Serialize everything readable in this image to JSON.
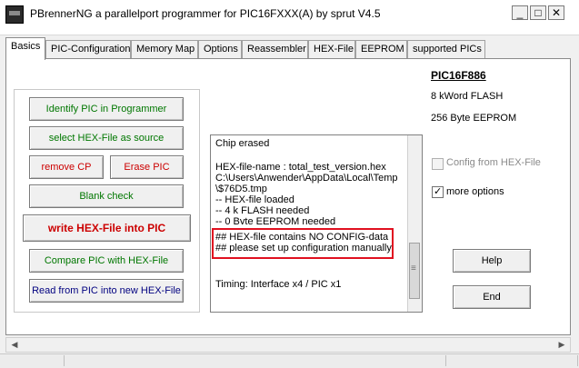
{
  "window": {
    "title": "PBrennerNG  a parallelport programmer for PIC16FXXX(A)  by sprut V4.5",
    "min_glyph": "_",
    "max_glyph": "□",
    "close_glyph": "✕"
  },
  "tabs": [
    {
      "label": "Basics"
    },
    {
      "label": "PIC-Configuration"
    },
    {
      "label": "Memory Map"
    },
    {
      "label": "Options"
    },
    {
      "label": "Reassembler"
    },
    {
      "label": "HEX-File"
    },
    {
      "label": "EEPROM"
    },
    {
      "label": "supported PICs"
    }
  ],
  "buttons": {
    "identify": "Identify PIC in Programmer",
    "select_hex": "select HEX-File as source",
    "remove_cp": "remove CP",
    "erase_pic": "Erase PIC",
    "blank_check": "Blank check",
    "write_hex": "write HEX-File into PIC",
    "compare": "Compare PIC with HEX-File",
    "read_from_pic": "Read from PIC into new HEX-File",
    "help": "Help",
    "end": "End"
  },
  "log": {
    "lines": [
      "Chip erased",
      "",
      "HEX-file-name : total_test_version.hex",
      "C:\\Users\\Anwender\\AppData\\Local\\Temp",
      "\\$76D5.tmp",
      "-- HEX-file loaded",
      "-- 4 k FLASH needed",
      "-- 0 Byte EEPROM needed",
      "## HEX-file contains NO CONFIG-data",
      "## please set up configuration manually",
      "",
      "",
      "Timing: Interface x4 / PIC x1"
    ]
  },
  "chip": {
    "name": "PIC16F886",
    "flash": "8 kWord FLASH",
    "eeprom": "256 Byte EEPROM"
  },
  "options": {
    "config_from_hex": {
      "label": "Config from HEX-File",
      "checked": false,
      "enabled": false
    },
    "more_options": {
      "label": "more options",
      "checked": true,
      "enabled": true
    }
  },
  "scroll": {
    "left_arrow": "◀",
    "right_arrow": "▶"
  }
}
